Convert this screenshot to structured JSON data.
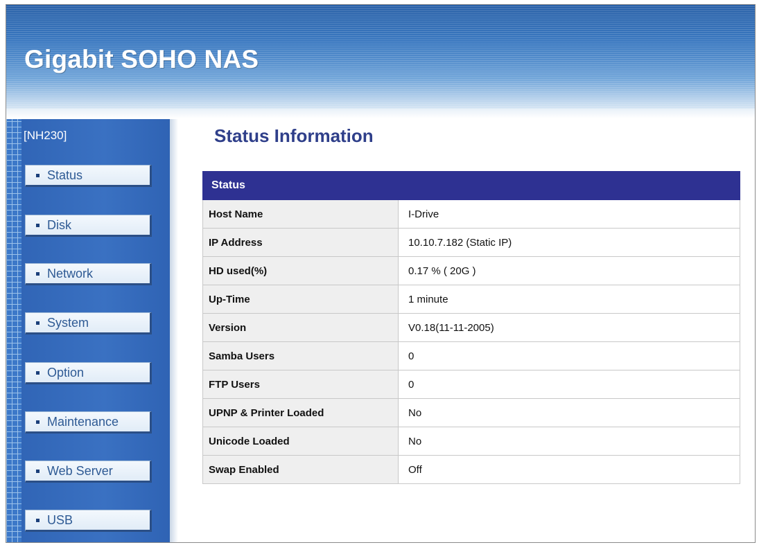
{
  "header": {
    "title": "Gigabit SOHO NAS"
  },
  "sidebar": {
    "device": "[NH230]",
    "items": [
      {
        "label": "Status"
      },
      {
        "label": "Disk"
      },
      {
        "label": "Network"
      },
      {
        "label": "System"
      },
      {
        "label": "Option"
      },
      {
        "label": "Maintenance"
      },
      {
        "label": "Web Server"
      },
      {
        "label": "USB"
      }
    ]
  },
  "main": {
    "title": "Status Information",
    "table": {
      "header": "Status",
      "rows": [
        {
          "label": "Host Name",
          "value": "I-Drive"
        },
        {
          "label": "IP Address",
          "value": "10.10.7.182 (Static IP)"
        },
        {
          "label": "HD used(%)",
          "value": "0.17 % ( 20G )"
        },
        {
          "label": "Up-Time",
          "value": "1 minute"
        },
        {
          "label": "Version",
          "value": "V0.18(11-11-2005)"
        },
        {
          "label": "Samba Users",
          "value": "0"
        },
        {
          "label": "FTP Users",
          "value": "0"
        },
        {
          "label": "UPNP & Printer Loaded",
          "value": "No"
        },
        {
          "label": "Unicode Loaded",
          "value": "No"
        },
        {
          "label": "Swap Enabled",
          "value": "Off"
        }
      ]
    }
  },
  "colors": {
    "banner": "#3f7ec3",
    "sidebar": "#3a71c2",
    "table_header": "#2e3192",
    "title_text": "#2f3f8a"
  }
}
